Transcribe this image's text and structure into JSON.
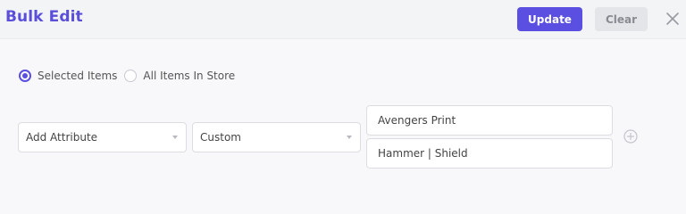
{
  "header": {
    "title": "Bulk Edit",
    "update_label": "Update",
    "clear_label": "Clear",
    "close_icon": "close-icon"
  },
  "scope": {
    "options": [
      {
        "label": "Selected Items",
        "selected": true
      },
      {
        "label": "All Items In Store",
        "selected": false
      }
    ]
  },
  "row": {
    "action_select": "Add Attribute",
    "type_select": "Custom",
    "attribute_name": "Avengers Print",
    "attribute_values": "Hammer | Shield",
    "add_icon": "plus-circle-icon"
  },
  "colors": {
    "accent": "#5a4fe0",
    "title": "#5b4fd9"
  }
}
